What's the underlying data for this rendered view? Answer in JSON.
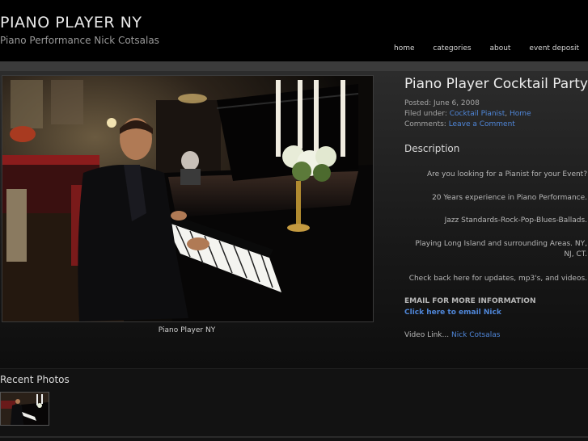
{
  "header": {
    "site_title": "PIANO PLAYER NY",
    "site_description": "Piano Performance Nick Cotsalas",
    "nav": [
      "home",
      "categories",
      "about",
      "event deposit"
    ]
  },
  "post": {
    "title": "Piano Player Cocktail Party",
    "posted_label": "Posted:",
    "posted_date": "June 6, 2008",
    "filed_label": "Filed under:",
    "filed_cat1": "Cocktail Pianist",
    "filed_sep": ",",
    "filed_cat2": "Home",
    "comments_label": "Comments:",
    "comments_link": "Leave a Comment",
    "photo_caption": "Piano Player NY"
  },
  "description": {
    "heading": "Description",
    "lines": [
      "Are you looking for a Pianist for your Event?",
      "20 Years experience in Piano Performance.",
      "Jazz Standards-Rock-Pop-Blues-Ballads.",
      "Playing Long Island and surrounding Areas. NY, NJ, CT.",
      "Check back here for updates, mp3's, and videos."
    ],
    "email_heading": "EMAIL FOR MORE INFORMATION",
    "email_link": "Click here to email Nick",
    "video_label": "Video Link...",
    "video_link": "Nick Cotsalas"
  },
  "recent": {
    "title": "Recent Photos"
  },
  "colors": {
    "background": "#000000",
    "link": "#4f86d8",
    "band": "#3b3b3b"
  }
}
